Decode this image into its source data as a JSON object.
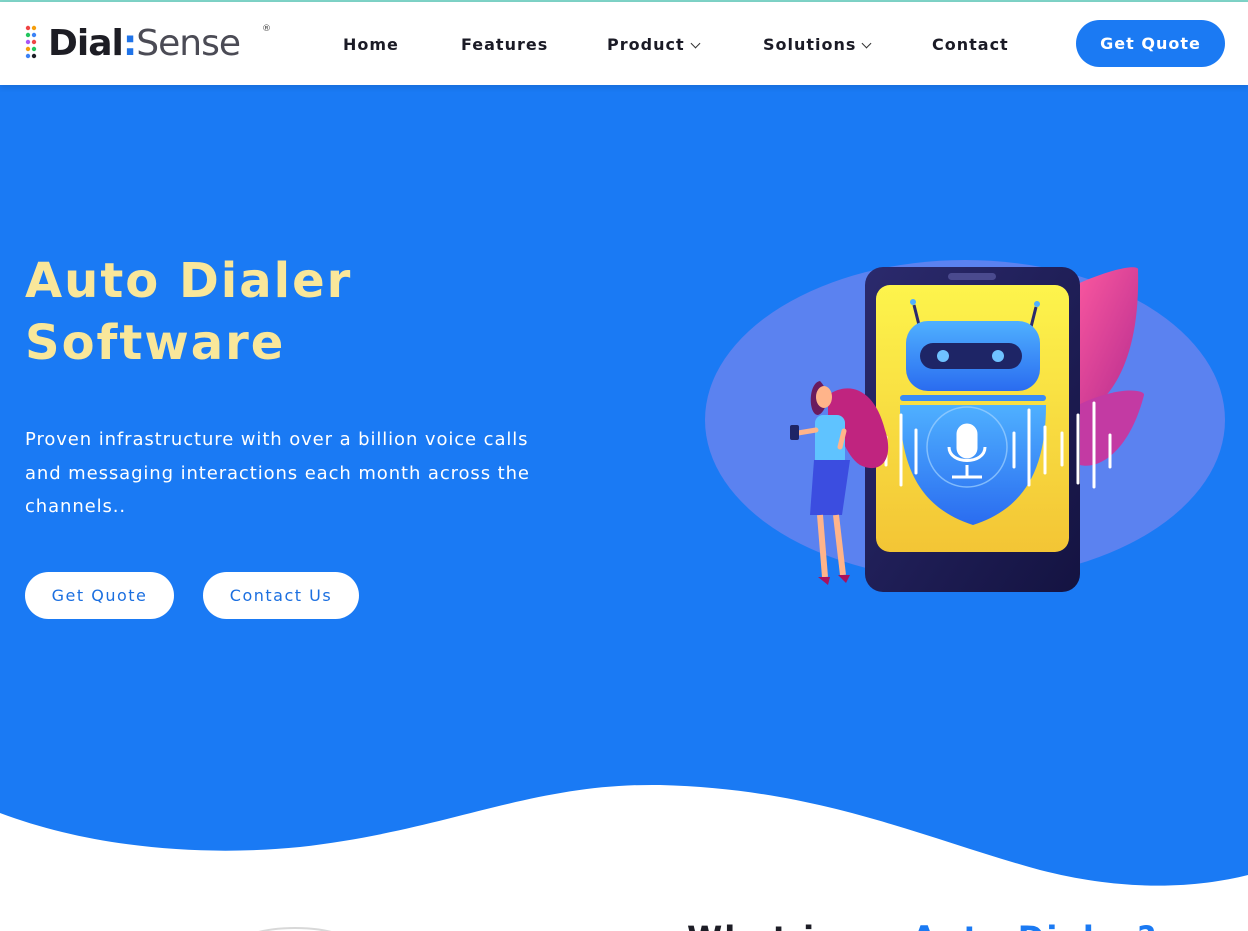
{
  "brand": {
    "name_primary": "Dial",
    "name_separator": ":",
    "name_secondary": "Sense",
    "registered_mark": "®",
    "colors": {
      "primary_blue": "#1a7af4",
      "title_yellow": "#f9e79a",
      "dark_text": "#1d1d26"
    }
  },
  "nav": {
    "items": [
      {
        "label": "Home",
        "has_dropdown": false
      },
      {
        "label": "Features",
        "has_dropdown": false
      },
      {
        "label": "Product",
        "has_dropdown": true
      },
      {
        "label": "Solutions",
        "has_dropdown": true
      },
      {
        "label": "Contact",
        "has_dropdown": false
      }
    ],
    "cta_label": "Get Quote"
  },
  "hero": {
    "title_line1": "Auto Dialer",
    "title_line2": "Software",
    "subtitle": "Proven infrastructure with over a billion voice calls and messaging interactions each month across the channels..",
    "primary_button": "Get Quote",
    "secondary_button": "Contact Us",
    "illustration_icons": [
      "robot-icon",
      "microphone-icon",
      "shield-icon",
      "smartphone-icon",
      "woman-figure"
    ]
  },
  "next_section": {
    "heading_dark": "What is an ",
    "heading_blue": "Auto Dialer?"
  }
}
